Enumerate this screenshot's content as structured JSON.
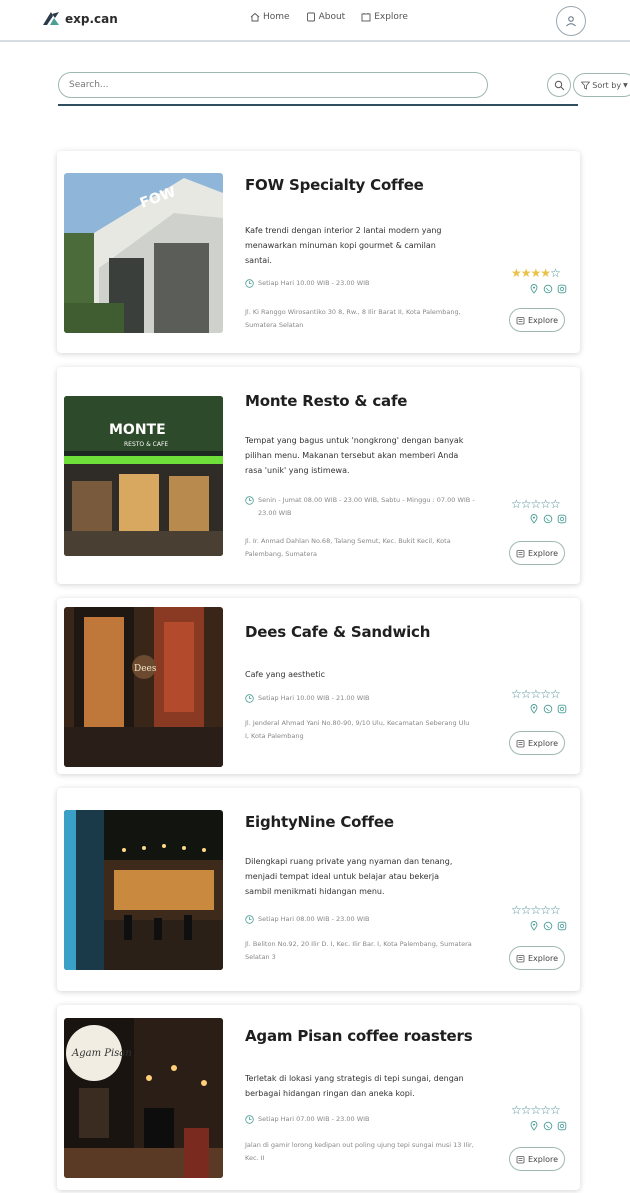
{
  "header": {
    "brand": "exp.can",
    "nav": [
      {
        "label": "Home",
        "icon": "home-icon"
      },
      {
        "label": "About",
        "icon": "about-icon"
      },
      {
        "label": "Explore",
        "icon": "explore-icon"
      }
    ],
    "profile_icon": "user-icon"
  },
  "search": {
    "placeholder": "Search...",
    "sort_label": "Sort by"
  },
  "colors": {
    "accent": "#4a9e96",
    "star_filled": "#e9c24a",
    "star_empty": "#4a8a93",
    "divider": "#2f4f5f"
  },
  "cards": [
    {
      "title": "FOW Specialty Coffee",
      "description": "Kafe trendi dengan interior 2 lantai modern yang menawarkan minuman kopi gourmet & camilan santai.",
      "hours": "Setiap Hari 10.00 WIB - 23.00 WIB",
      "address": "Jl. Ki Ranggo Wirosantiko 30 8, Rw., 8 Ilir Barat II, Kota Palembang, Sumatera Selatan",
      "rating": 4,
      "explore_label": "Explore"
    },
    {
      "title": "Monte Resto & cafe",
      "description": "Tempat yang bagus untuk 'nongkrong' dengan banyak pilihan menu. Makanan tersebut akan memberi Anda rasa 'unik' yang istimewa.",
      "hours": "Senin - Jumat 08.00 WIB - 23.00 WIB, Sabtu - Minggu : 07.00 WIB - 23.00 WIB",
      "address": "Jl. Ir. Anmad Dahlan No.68, Talang Semut, Kec. Bukit Kecil, Kota Palembang, Sumatera",
      "rating": 0,
      "explore_label": "Explore"
    },
    {
      "title": "Dees Cafe & Sandwich",
      "description": "Cafe yang aesthetic",
      "hours": "Setiap Hari 10.00 WIB - 21.00 WIB",
      "address": "Jl. Jenderal Ahmad Yani No.80-90, 9/10 Ulu, Kecamatan Seberang Ulu I, Kota Palembang",
      "rating": 0,
      "explore_label": "Explore"
    },
    {
      "title": "EightyNine Coffee",
      "description": "Dilengkapi ruang private yang nyaman dan tenang, menjadi tempat ideal untuk belajar atau bekerja sambil menikmati hidangan menu.",
      "hours": "Setiap Hari 08.00 WIB - 23.00 WIB",
      "address": "Jl. Beliton No.92, 20 Ilir D. I, Kec. Ilir Bar. I, Kota Palembang, Sumatera Selatan 3",
      "rating": 0,
      "explore_label": "Explore"
    },
    {
      "title": "Agam Pisan coffee roasters",
      "description": "Terletak di lokasi yang strategis di tepi sungai, dengan berbagai hidangan ringan dan aneka kopi.",
      "hours": "Setiap Hari 07.00 WIB - 23.00 WIB",
      "address": "Jalan di gamir lorong kedipan out poling ujung tepi sungai musi 13 Ilir, Kec. II",
      "rating": 0,
      "explore_label": "Explore"
    }
  ]
}
